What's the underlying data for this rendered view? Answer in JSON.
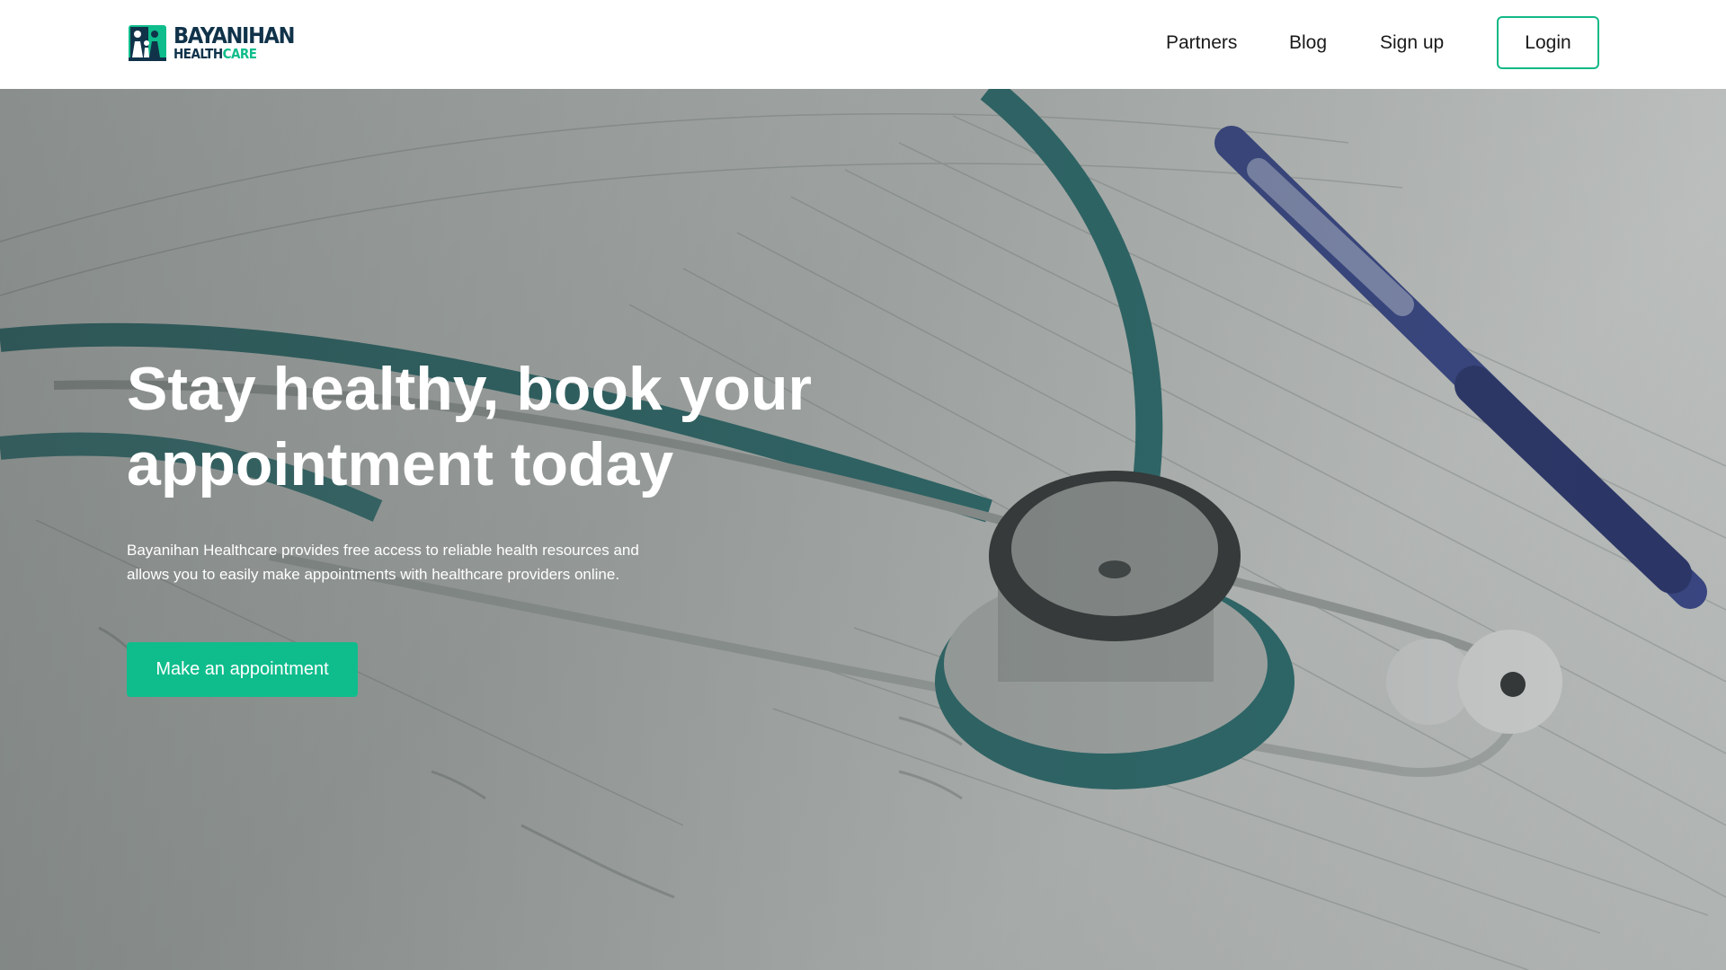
{
  "brand": {
    "name_line1": "BAYANIHAN",
    "name_line2_a": "HEALTH",
    "name_line2_b": "CARE",
    "colors": {
      "navy": "#10334a",
      "green": "#0fbd8c"
    },
    "logo_icon": "family-icon"
  },
  "nav": {
    "links": [
      "Partners",
      "Blog",
      "Sign up"
    ],
    "login_label": "Login"
  },
  "hero": {
    "title_line1": "Stay healthy, book your",
    "title_line2": "appointment today",
    "description": "Bayanihan Healthcare provides free access to reliable health resources and allows you to easily make appointments with healthcare providers online.",
    "cta_label": "Make an appointment",
    "background": "stethoscope-and-pen-on-schedule-photo"
  }
}
